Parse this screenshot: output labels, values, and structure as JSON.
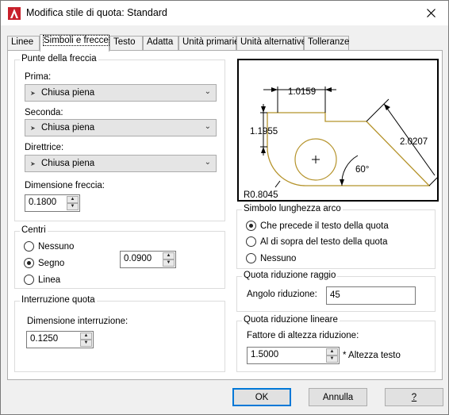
{
  "window": {
    "title": "Modifica stile di quota: Standard",
    "accent": "#c8202b"
  },
  "tabs": [
    {
      "label": "Linee",
      "active": false
    },
    {
      "label": "Simboli e frecce",
      "active": true
    },
    {
      "label": "Testo",
      "active": false
    },
    {
      "label": "Adatta",
      "active": false
    },
    {
      "label": "Unità primarie",
      "active": false
    },
    {
      "label": "Unità alternative",
      "active": false
    },
    {
      "label": "Tolleranze",
      "active": false
    }
  ],
  "arrowheads": {
    "title": "Punte della freccia",
    "first_label": "Prima:",
    "first_value": "Chiusa piena",
    "second_label": "Seconda:",
    "second_value": "Chiusa piena",
    "leader_label": "Direttrice:",
    "leader_value": "Chiusa piena",
    "size_label": "Dimensione freccia:",
    "size_value": "0.1800"
  },
  "center_marks": {
    "title": "Centri",
    "options": [
      {
        "label": "Nessuno",
        "selected": false
      },
      {
        "label": "Segno",
        "selected": true
      },
      {
        "label": "Linea",
        "selected": false
      }
    ],
    "size_value": "0.0900"
  },
  "dim_break": {
    "title": "Interruzione quota",
    "size_label": "Dimensione interruzione:",
    "size_value": "0.1250"
  },
  "preview": {
    "dim_top": "1.0159",
    "dim_left": "1.1955",
    "dim_right": "2.0207",
    "angle": "60°",
    "radius": "R0.8045",
    "shape_color": "#b5932b"
  },
  "arc_length": {
    "title": "Simbolo lunghezza arco",
    "options": [
      {
        "label": "Che precede il testo della quota",
        "selected": true
      },
      {
        "label": "Al di sopra del testo della quota",
        "selected": false
      },
      {
        "label": "Nessuno",
        "selected": false
      }
    ]
  },
  "radius_jog": {
    "title": "Quota riduzione raggio",
    "angle_label": "Angolo riduzione:",
    "angle_value": "45"
  },
  "linear_jog": {
    "title": "Quota riduzione lineare",
    "factor_label": "Fattore di altezza riduzione:",
    "factor_value": "1.5000",
    "suffix": "* Altezza testo"
  },
  "buttons": {
    "ok": "OK",
    "cancel": "Annulla",
    "help": "?"
  }
}
